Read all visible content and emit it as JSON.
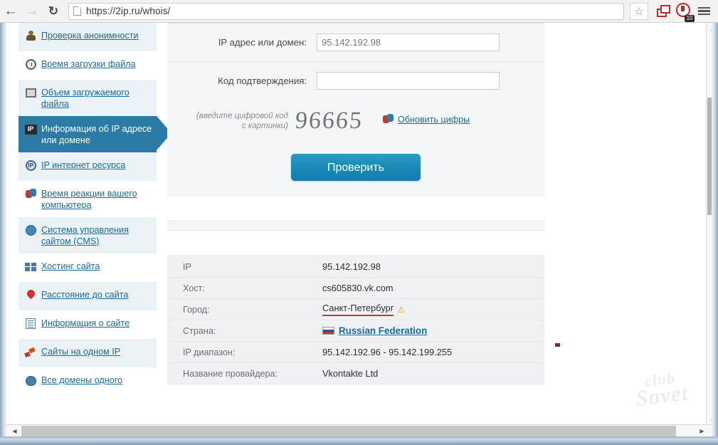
{
  "browser": {
    "back_icon": "back-arrow-icon",
    "forward_icon": "forward-arrow-icon",
    "reload_icon": "reload-icon",
    "url": "https://2ip.ru/whois/",
    "star_glyph": "☆",
    "badge_count": "10"
  },
  "sidebar": {
    "items": [
      {
        "label": "Проверка анонимности",
        "icon": "person-icon",
        "active": false,
        "alt": true
      },
      {
        "label": "Время загрузки файла",
        "icon": "clock-icon",
        "active": false,
        "alt": false
      },
      {
        "label": "Объем загружаемого файла",
        "icon": "monitor-icon",
        "active": false,
        "alt": true
      },
      {
        "label": "Информация об IP адресе или домене",
        "icon": "ip-badge-icon",
        "active": true,
        "alt": false
      },
      {
        "label": "IP интернет ресурса",
        "icon": "ip-circle-icon",
        "active": false,
        "alt": true
      },
      {
        "label": "Время реакции вашего компьютера",
        "icon": "refresh-arrows-icon",
        "active": false,
        "alt": false
      },
      {
        "label": "Система управления сайтом (CMS)",
        "icon": "globe-icon",
        "active": false,
        "alt": true
      },
      {
        "label": "Хостинг сайта",
        "icon": "hosting-grid-icon",
        "active": false,
        "alt": false
      },
      {
        "label": "Расстояние до сайта",
        "icon": "map-pin-icon",
        "active": false,
        "alt": true
      },
      {
        "label": "Информация о сайте",
        "icon": "document-icon",
        "active": false,
        "alt": false
      },
      {
        "label": "Сайты на одном IP",
        "icon": "sites-icon",
        "active": false,
        "alt": true
      },
      {
        "label": "Все домены одного",
        "icon": "domains-icon",
        "active": false,
        "alt": false
      }
    ]
  },
  "form": {
    "ip_label": "IP адрес или домен:",
    "ip_value": "95.142.192.98",
    "ip_placeholder": "95.142.192.98",
    "code_label": "Код подтверждения:",
    "code_value": "",
    "code_placeholder": "",
    "captcha_hint_line1": "(введите цифровой код",
    "captcha_hint_line2": "с картинки)",
    "captcha_digits": "96665",
    "refresh_label": "Обновить цифры",
    "refresh_icon": "refresh-captcha-icon",
    "submit_label": "Проверить"
  },
  "results": {
    "rows": [
      {
        "key": "IP",
        "value": "95.142.192.98",
        "kind": "text"
      },
      {
        "key": "Хост:",
        "value": "cs605830.vk.com",
        "kind": "text"
      },
      {
        "key": "Город:",
        "value": "Санкт-Петербург",
        "kind": "city",
        "warn_icon": "warning-triangle-icon"
      },
      {
        "key": "Страна:",
        "value": "Russian Federation",
        "kind": "link",
        "flag_icon": "russia-flag-icon"
      },
      {
        "key": "IP диапазон:",
        "value": "95.142.192.96 - 95.142.199.255",
        "kind": "text"
      },
      {
        "key": "Название провайдера:",
        "value": "Vkontakte Ltd",
        "kind": "text"
      }
    ]
  },
  "watermark": {
    "line1": "club",
    "line2": "Sovet"
  },
  "colors": {
    "accent_blue": "#1a6a9e",
    "active_sidebar": "#2c7aa6",
    "button_blue": "#1a8cb8",
    "underline_red": "#c0392b"
  }
}
